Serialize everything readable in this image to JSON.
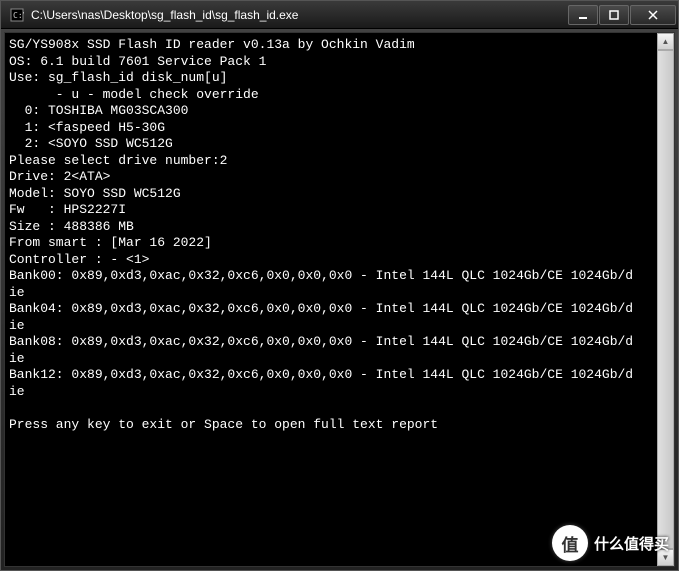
{
  "window": {
    "title": "C:\\Users\\nas\\Desktop\\sg_flash_id\\sg_flash_id.exe"
  },
  "console": {
    "lines": [
      "SG/YS908x SSD Flash ID reader v0.13a by Ochkin Vadim",
      "OS: 6.1 build 7601 Service Pack 1",
      "Use: sg_flash_id disk_num[u]",
      "      - u - model check override",
      "  0: TOSHIBA MG03SCA300",
      "  1: <faspeed H5-30G",
      "  2: <SOYO SSD WC512G",
      "Please select drive number:2",
      "Drive: 2<ATA>",
      "Model: SOYO SSD WC512G",
      "Fw   : HPS2227I",
      "Size : 488386 MB",
      "From smart : [Mar 16 2022]",
      "Controller : - <1>",
      "Bank00: 0x89,0xd3,0xac,0x32,0xc6,0x0,0x0,0x0 - Intel 144L QLC 1024Gb/CE 1024Gb/d",
      "ie",
      "Bank04: 0x89,0xd3,0xac,0x32,0xc6,0x0,0x0,0x0 - Intel 144L QLC 1024Gb/CE 1024Gb/d",
      "ie",
      "Bank08: 0x89,0xd3,0xac,0x32,0xc6,0x0,0x0,0x0 - Intel 144L QLC 1024Gb/CE 1024Gb/d",
      "ie",
      "Bank12: 0x89,0xd3,0xac,0x32,0xc6,0x0,0x0,0x0 - Intel 144L QLC 1024Gb/CE 1024Gb/d",
      "ie",
      "",
      "Press any key to exit or Space to open full text report"
    ]
  },
  "watermark": {
    "icon": "值",
    "text": "什么值得买"
  }
}
